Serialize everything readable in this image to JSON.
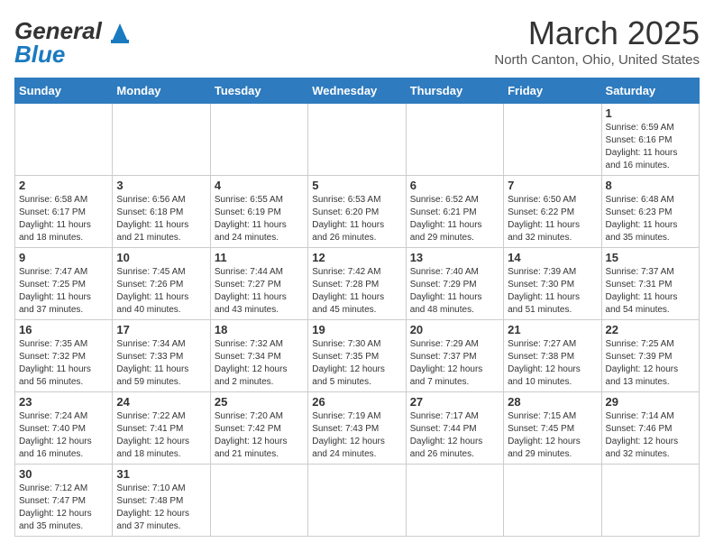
{
  "header": {
    "logo_text_general": "General",
    "logo_text_blue": "Blue",
    "title": "March 2025",
    "subtitle": "North Canton, Ohio, United States"
  },
  "days_of_week": [
    "Sunday",
    "Monday",
    "Tuesday",
    "Wednesday",
    "Thursday",
    "Friday",
    "Saturday"
  ],
  "weeks": [
    [
      {
        "day": "",
        "info": ""
      },
      {
        "day": "",
        "info": ""
      },
      {
        "day": "",
        "info": ""
      },
      {
        "day": "",
        "info": ""
      },
      {
        "day": "",
        "info": ""
      },
      {
        "day": "",
        "info": ""
      },
      {
        "day": "1",
        "info": "Sunrise: 6:59 AM\nSunset: 6:16 PM\nDaylight: 11 hours\nand 16 minutes."
      }
    ],
    [
      {
        "day": "2",
        "info": "Sunrise: 6:58 AM\nSunset: 6:17 PM\nDaylight: 11 hours\nand 18 minutes."
      },
      {
        "day": "3",
        "info": "Sunrise: 6:56 AM\nSunset: 6:18 PM\nDaylight: 11 hours\nand 21 minutes."
      },
      {
        "day": "4",
        "info": "Sunrise: 6:55 AM\nSunset: 6:19 PM\nDaylight: 11 hours\nand 24 minutes."
      },
      {
        "day": "5",
        "info": "Sunrise: 6:53 AM\nSunset: 6:20 PM\nDaylight: 11 hours\nand 26 minutes."
      },
      {
        "day": "6",
        "info": "Sunrise: 6:52 AM\nSunset: 6:21 PM\nDaylight: 11 hours\nand 29 minutes."
      },
      {
        "day": "7",
        "info": "Sunrise: 6:50 AM\nSunset: 6:22 PM\nDaylight: 11 hours\nand 32 minutes."
      },
      {
        "day": "8",
        "info": "Sunrise: 6:48 AM\nSunset: 6:23 PM\nDaylight: 11 hours\nand 35 minutes."
      }
    ],
    [
      {
        "day": "9",
        "info": "Sunrise: 7:47 AM\nSunset: 7:25 PM\nDaylight: 11 hours\nand 37 minutes."
      },
      {
        "day": "10",
        "info": "Sunrise: 7:45 AM\nSunset: 7:26 PM\nDaylight: 11 hours\nand 40 minutes."
      },
      {
        "day": "11",
        "info": "Sunrise: 7:44 AM\nSunset: 7:27 PM\nDaylight: 11 hours\nand 43 minutes."
      },
      {
        "day": "12",
        "info": "Sunrise: 7:42 AM\nSunset: 7:28 PM\nDaylight: 11 hours\nand 45 minutes."
      },
      {
        "day": "13",
        "info": "Sunrise: 7:40 AM\nSunset: 7:29 PM\nDaylight: 11 hours\nand 48 minutes."
      },
      {
        "day": "14",
        "info": "Sunrise: 7:39 AM\nSunset: 7:30 PM\nDaylight: 11 hours\nand 51 minutes."
      },
      {
        "day": "15",
        "info": "Sunrise: 7:37 AM\nSunset: 7:31 PM\nDaylight: 11 hours\nand 54 minutes."
      }
    ],
    [
      {
        "day": "16",
        "info": "Sunrise: 7:35 AM\nSunset: 7:32 PM\nDaylight: 11 hours\nand 56 minutes."
      },
      {
        "day": "17",
        "info": "Sunrise: 7:34 AM\nSunset: 7:33 PM\nDaylight: 11 hours\nand 59 minutes."
      },
      {
        "day": "18",
        "info": "Sunrise: 7:32 AM\nSunset: 7:34 PM\nDaylight: 12 hours\nand 2 minutes."
      },
      {
        "day": "19",
        "info": "Sunrise: 7:30 AM\nSunset: 7:35 PM\nDaylight: 12 hours\nand 5 minutes."
      },
      {
        "day": "20",
        "info": "Sunrise: 7:29 AM\nSunset: 7:37 PM\nDaylight: 12 hours\nand 7 minutes."
      },
      {
        "day": "21",
        "info": "Sunrise: 7:27 AM\nSunset: 7:38 PM\nDaylight: 12 hours\nand 10 minutes."
      },
      {
        "day": "22",
        "info": "Sunrise: 7:25 AM\nSunset: 7:39 PM\nDaylight: 12 hours\nand 13 minutes."
      }
    ],
    [
      {
        "day": "23",
        "info": "Sunrise: 7:24 AM\nSunset: 7:40 PM\nDaylight: 12 hours\nand 16 minutes."
      },
      {
        "day": "24",
        "info": "Sunrise: 7:22 AM\nSunset: 7:41 PM\nDaylight: 12 hours\nand 18 minutes."
      },
      {
        "day": "25",
        "info": "Sunrise: 7:20 AM\nSunset: 7:42 PM\nDaylight: 12 hours\nand 21 minutes."
      },
      {
        "day": "26",
        "info": "Sunrise: 7:19 AM\nSunset: 7:43 PM\nDaylight: 12 hours\nand 24 minutes."
      },
      {
        "day": "27",
        "info": "Sunrise: 7:17 AM\nSunset: 7:44 PM\nDaylight: 12 hours\nand 26 minutes."
      },
      {
        "day": "28",
        "info": "Sunrise: 7:15 AM\nSunset: 7:45 PM\nDaylight: 12 hours\nand 29 minutes."
      },
      {
        "day": "29",
        "info": "Sunrise: 7:14 AM\nSunset: 7:46 PM\nDaylight: 12 hours\nand 32 minutes."
      }
    ],
    [
      {
        "day": "30",
        "info": "Sunrise: 7:12 AM\nSunset: 7:47 PM\nDaylight: 12 hours\nand 35 minutes."
      },
      {
        "day": "31",
        "info": "Sunrise: 7:10 AM\nSunset: 7:48 PM\nDaylight: 12 hours\nand 37 minutes."
      },
      {
        "day": "",
        "info": ""
      },
      {
        "day": "",
        "info": ""
      },
      {
        "day": "",
        "info": ""
      },
      {
        "day": "",
        "info": ""
      },
      {
        "day": "",
        "info": ""
      }
    ]
  ]
}
